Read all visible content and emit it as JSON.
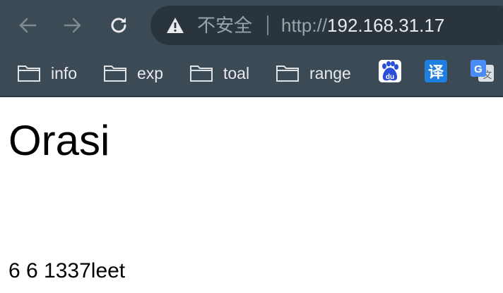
{
  "browser": {
    "colors": {
      "chrome_bg": "#3c4a55",
      "omnibox_bg": "#2a343c",
      "text": "#e8eaed",
      "muted": "#9aa4ab"
    },
    "nav": {
      "back_icon": "arrow-left-icon",
      "forward_icon": "arrow-right-icon",
      "reload_icon": "reload-icon"
    },
    "address_bar": {
      "security_icon": "warning-triangle-icon",
      "security_label": "不安全",
      "url_scheme": "http://",
      "url_host": "192.168.31.17"
    },
    "bookmarks": [
      {
        "label": "info",
        "icon": "folder-icon"
      },
      {
        "label": "exp",
        "icon": "folder-icon"
      },
      {
        "label": "toal",
        "icon": "folder-icon"
      },
      {
        "label": "range",
        "icon": "folder-icon"
      }
    ],
    "bookmark_icons": [
      {
        "name": "baidu-du-icon",
        "text": "du"
      },
      {
        "name": "translate-icon",
        "text": "译"
      },
      {
        "name": "google-translate-icon",
        "text": "G"
      }
    ]
  },
  "page": {
    "heading": "Orasi",
    "text": "6 6 1337leet"
  }
}
